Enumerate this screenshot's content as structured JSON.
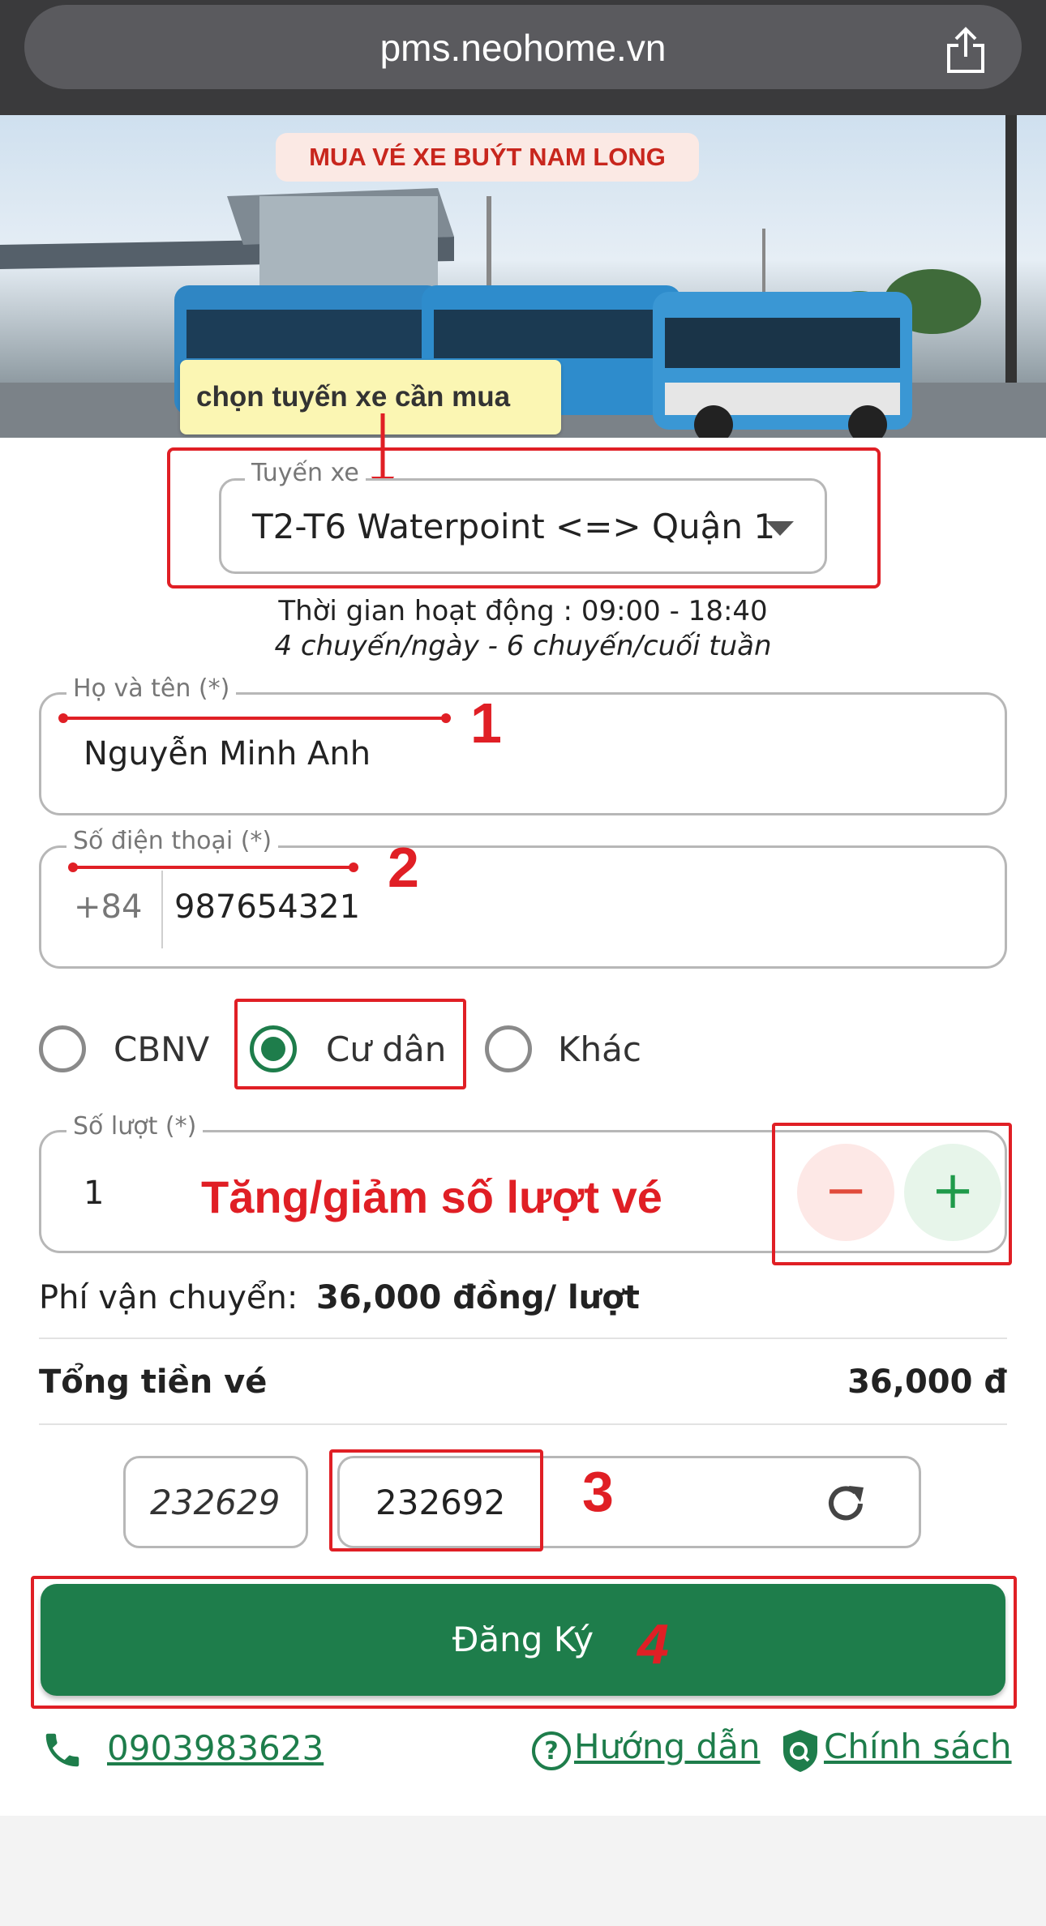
{
  "browser": {
    "url": "pms.neohome.vn"
  },
  "banner": {
    "title": "MUA VÉ XE BUÝT NAM LONG"
  },
  "tooltip": "chọn tuyến xe cần mua",
  "route": {
    "label": "Tuyến xe",
    "value": "T2-T6 Waterpoint <=> Quận 1",
    "hours": "Thời gian hoạt động : 09:00 - 18:40",
    "trips": "4 chuyến/ngày - 6 chuyến/cuối tuần"
  },
  "name_field": {
    "label": "Họ và tên (*)",
    "value": "Nguyễn Minh Anh"
  },
  "phone_field": {
    "label": "Số điện thoại (*)",
    "prefix": "+84",
    "value": "987654321"
  },
  "customer_type": {
    "options": [
      {
        "label": "CBNV",
        "checked": false
      },
      {
        "label": "Cư dân",
        "checked": true
      },
      {
        "label": "Khác",
        "checked": false
      }
    ]
  },
  "quantity": {
    "label": "Số lượt (*)",
    "value": "1",
    "minus": "−",
    "plus": "+"
  },
  "annotations": {
    "n1": "1",
    "n2": "2",
    "n3": "3",
    "n4": "4",
    "stepper_note": "Tăng/giảm số lượt vé"
  },
  "fee": {
    "label": "Phí vận chuyển:",
    "value": "36,000 đồng/ lượt"
  },
  "total": {
    "label": "Tổng tiền vé",
    "value": "36,000 đ"
  },
  "captcha": {
    "code": "232629",
    "input": "232692"
  },
  "submit_label": "Đăng Ký",
  "footer": {
    "phone": "0903983623",
    "guide": "Hướng dẫn",
    "policy": "Chính sách"
  },
  "colors": {
    "primary": "#1e7d4b",
    "annotation": "#e01f25",
    "tooltip": "#fbf6b3"
  }
}
